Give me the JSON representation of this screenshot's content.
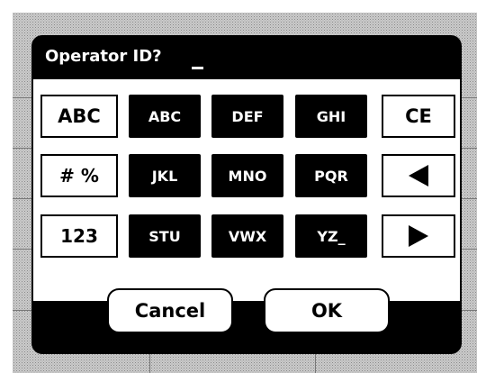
{
  "dialog": {
    "prompt": "Operator ID?",
    "entry_value": ""
  },
  "keypad": {
    "rows": [
      [
        {
          "label": "ABC",
          "style": "light"
        },
        {
          "label": "ABC",
          "style": "dark"
        },
        {
          "label": "DEF",
          "style": "dark"
        },
        {
          "label": "GHI",
          "style": "dark"
        },
        {
          "label": "CE",
          "style": "light"
        }
      ],
      [
        {
          "label": "# %",
          "style": "light"
        },
        {
          "label": "JKL",
          "style": "dark"
        },
        {
          "label": "MNO",
          "style": "dark"
        },
        {
          "label": "PQR",
          "style": "dark"
        },
        {
          "icon": "left-arrow-icon",
          "style": "light"
        }
      ],
      [
        {
          "label": "123",
          "style": "light"
        },
        {
          "label": "STU",
          "style": "dark"
        },
        {
          "label": "VWX",
          "style": "dark"
        },
        {
          "label": "YZ_",
          "style": "dark"
        },
        {
          "icon": "right-arrow-icon",
          "style": "light"
        }
      ]
    ]
  },
  "buttons": {
    "cancel": "Cancel",
    "ok": "OK"
  }
}
